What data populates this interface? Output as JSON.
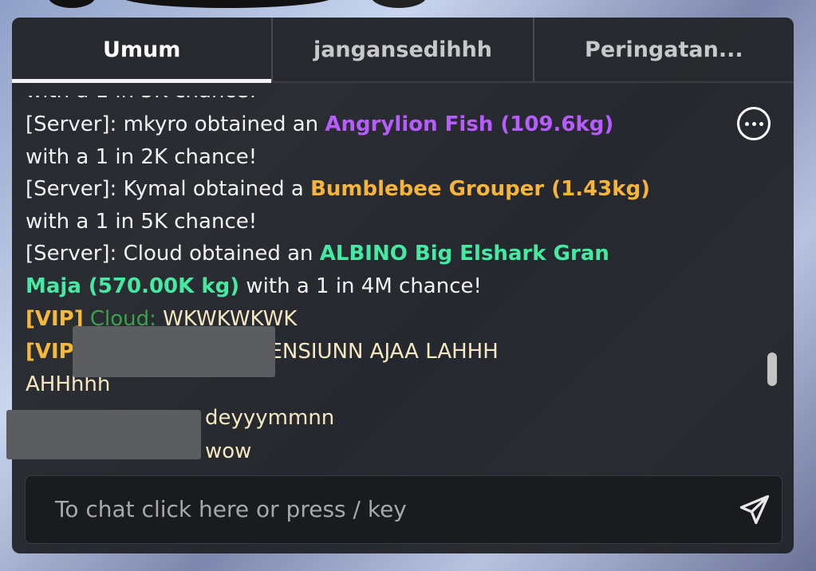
{
  "tabs": [
    {
      "label": "Umum"
    },
    {
      "label": "jangansedihhh"
    },
    {
      "label": "Peringatan..."
    }
  ],
  "messages": [
    {
      "prefix": "[Server]:",
      "text": " mkyro obtained an ",
      "item": "Angrylion Fish (109.6kg)",
      "line2": "with a 1 in 2K chance!"
    },
    {
      "prefix": "[Server]:",
      "text": " Kymal obtained a ",
      "item": "Bumblebee Grouper (1.43kg)",
      "line2": "with a 1 in 5K chance!"
    },
    {
      "prefix": "[Server]:",
      "text": " Cloud obtained an ",
      "item_line1": "ALBINO Big Elshark Gran",
      "item_line2": "Maja (570.00K kg)",
      "tail": " with a 1 in 4M chance!"
    },
    {
      "tag": "[VIP]",
      "name": " Cloud:",
      "text": " WKWKWKWK"
    },
    {
      "tag": "[VIP",
      "text": ": PENSIUNN AJAA LAHHH",
      "line2": "AHHhhh"
    },
    {
      "text": "deyyymmnn"
    },
    {
      "text": "wow"
    }
  ],
  "input": {
    "placeholder": "To chat click here or press / key"
  },
  "icons": {
    "more": "ellipsis-circle-icon",
    "send": "paper-plane-send-icon"
  }
}
